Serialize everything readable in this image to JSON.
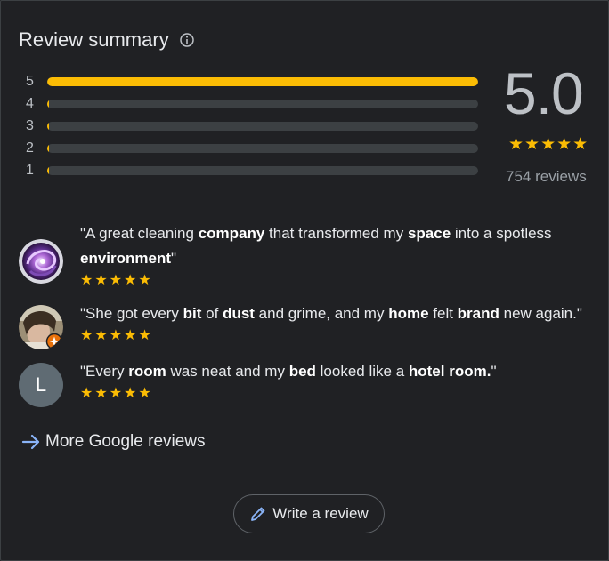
{
  "summary": {
    "title": "Review summary",
    "rating": "5.0",
    "stars": "★★★★★",
    "review_count": "754 reviews",
    "distribution": [
      {
        "label": "5",
        "fraction": 1.0
      },
      {
        "label": "4",
        "fraction": 0.0
      },
      {
        "label": "3",
        "fraction": 0.0
      },
      {
        "label": "2",
        "fraction": 0.0
      },
      {
        "label": "1",
        "fraction": 0.0
      }
    ]
  },
  "reviews": [
    {
      "parts": [
        {
          "t": "\"A great cleaning ",
          "b": false
        },
        {
          "t": "company",
          "b": true
        },
        {
          "t": " that transformed my ",
          "b": false
        },
        {
          "t": "space",
          "b": true
        },
        {
          "t": " into a spotless ",
          "b": false
        },
        {
          "t": "environment",
          "b": true
        },
        {
          "t": "\"",
          "b": false
        }
      ],
      "stars": "★★★★★",
      "avatar": "galaxy-avatar"
    },
    {
      "parts": [
        {
          "t": "\"She got every ",
          "b": false
        },
        {
          "t": "bit",
          "b": true
        },
        {
          "t": " of ",
          "b": false
        },
        {
          "t": "dust",
          "b": true
        },
        {
          "t": " and grime, and my ",
          "b": false
        },
        {
          "t": "home",
          "b": true
        },
        {
          "t": " felt ",
          "b": false
        },
        {
          "t": "brand",
          "b": true
        },
        {
          "t": " new again.\"",
          "b": false
        }
      ],
      "stars": "★★★★★",
      "avatar": "photo-avatar"
    },
    {
      "parts": [
        {
          "t": "\"Every ",
          "b": false
        },
        {
          "t": "room",
          "b": true
        },
        {
          "t": " was neat and my ",
          "b": false
        },
        {
          "t": "bed",
          "b": true
        },
        {
          "t": " looked like a ",
          "b": false
        },
        {
          "t": "hotel room.",
          "b": true
        },
        {
          "t": "\"",
          "b": false
        }
      ],
      "stars": "★★★★★",
      "avatar_letter": "L"
    }
  ],
  "more_link": "More Google reviews",
  "write_review": "Write a review",
  "colors": {
    "background": "#202124",
    "star": "#fbbc04",
    "link_arrow": "#8ab4f8",
    "letter_avatar": "#5f6b73"
  }
}
